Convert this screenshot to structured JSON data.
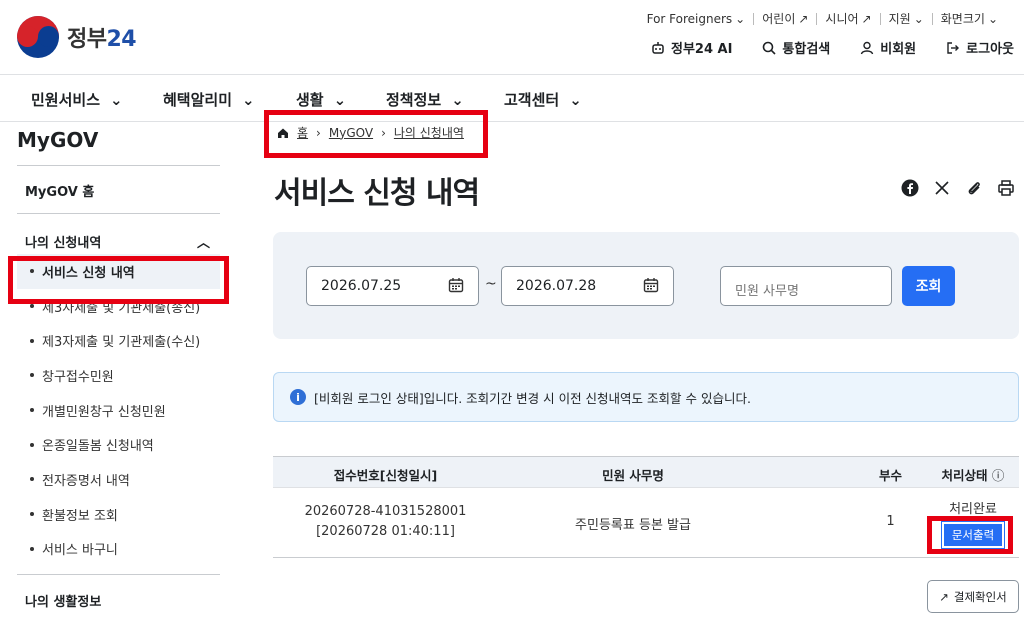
{
  "header": {
    "logo_text": "정부",
    "logo_num": "24",
    "utility": [
      "For Foreigners",
      "어린이",
      "시니어",
      "지원",
      "화면크기"
    ],
    "top_links": [
      "정부24 AI",
      "통합검색",
      "비회원",
      "로그아웃"
    ]
  },
  "gnb": [
    "민원서비스",
    "혜택알리미",
    "생활",
    "정책정보",
    "고객센터"
  ],
  "sidebar": {
    "title": "MyGOV",
    "home": "MyGOV 홈",
    "group": "나의 신청내역",
    "items": [
      {
        "label": "서비스 신청 내역",
        "active": true
      },
      {
        "label": "제3자제출 및 기관제출(송신)"
      },
      {
        "label": "제3자제출 및 기관제출(수신)"
      },
      {
        "label": "창구접수민원"
      },
      {
        "label": "개별민원창구 신청민원"
      },
      {
        "label": "온종일돌봄 신청내역"
      },
      {
        "label": "전자증명서 내역"
      },
      {
        "label": "환불정보 조회"
      },
      {
        "label": "서비스 바구니"
      }
    ],
    "next_group": "나의 생활정보"
  },
  "breadcrumb": [
    "홈",
    "MyGOV",
    "나의 신청내역"
  ],
  "page_title": "서비스 신청 내역",
  "filter": {
    "start_date": "2026.07.25",
    "separator": "~",
    "end_date": "2026.07.28",
    "search_placeholder": "민원 사무명",
    "search_button": "조회"
  },
  "notice": "[비회원 로그인 상태]입니다. 조회기간 변경 시 이전 신청내역도 조회할 수 있습니다.",
  "table": {
    "headers": [
      "접수번호[신청일시]",
      "민원 사무명",
      "부수",
      "처리상태"
    ],
    "rows": [
      {
        "receipt_no": "20260728-41031528001",
        "datetime": "[20260728 01:40:11]",
        "name": "주민등록표 등본 발급",
        "count": "1",
        "status": "처리완료",
        "action": "문서출력"
      }
    ]
  },
  "receipt_button": "결제확인서",
  "colors": {
    "accent": "#256ef4",
    "highlight": "#e60012",
    "panel": "#eef2f7"
  }
}
